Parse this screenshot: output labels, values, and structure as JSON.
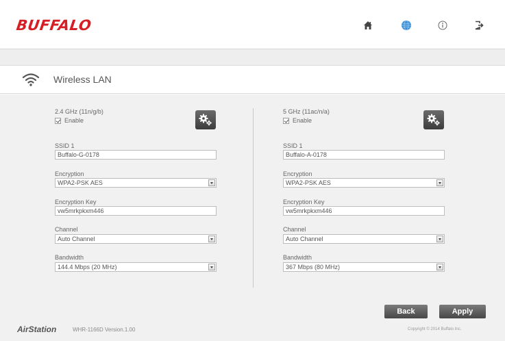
{
  "header": {
    "logo_text": "BUFFALO",
    "nav_icons": [
      "home-icon",
      "globe-icon",
      "info-icon",
      "logout-icon"
    ]
  },
  "section": {
    "title": "Wireless LAN",
    "icon": "wifi-icon"
  },
  "band_24": {
    "band_label": "2.4 GHz (11n/g/b)",
    "enable_label": "Enable",
    "enabled": true,
    "ssid_label": "SSID 1",
    "ssid_value": "Buffalo-G-0178",
    "encryption_label": "Encryption",
    "encryption_value": "WPA2-PSK AES",
    "key_label": "Encryption Key",
    "key_value": "vw5mrkpkxm446",
    "channel_label": "Channel",
    "channel_value": "Auto Channel",
    "bandwidth_label": "Bandwidth",
    "bandwidth_value": "144.4 Mbps (20 MHz)"
  },
  "band_5": {
    "band_label": "5 GHz (11ac/n/a)",
    "enable_label": "Enable",
    "enabled": true,
    "ssid_label": "SSID 1",
    "ssid_value": "Buffalo-A-0178",
    "encryption_label": "Encryption",
    "encryption_value": "WPA2-PSK AES",
    "key_label": "Encryption Key",
    "key_value": "vw5mrkpkxm446",
    "channel_label": "Channel",
    "channel_value": "Auto Channel",
    "bandwidth_label": "Bandwidth",
    "bandwidth_value": "367 Mbps (80 MHz)"
  },
  "actions": {
    "back_label": "Back",
    "apply_label": "Apply"
  },
  "footer": {
    "brand": "AirStation",
    "model_version": "WHR-1166D Version.1.00",
    "copyright": "Copyright © 2014 Buffalo Inc."
  },
  "colors": {
    "brand_red": "#d51f26",
    "globe_blue": "#3c8fd8",
    "button_dark": "#474747"
  }
}
